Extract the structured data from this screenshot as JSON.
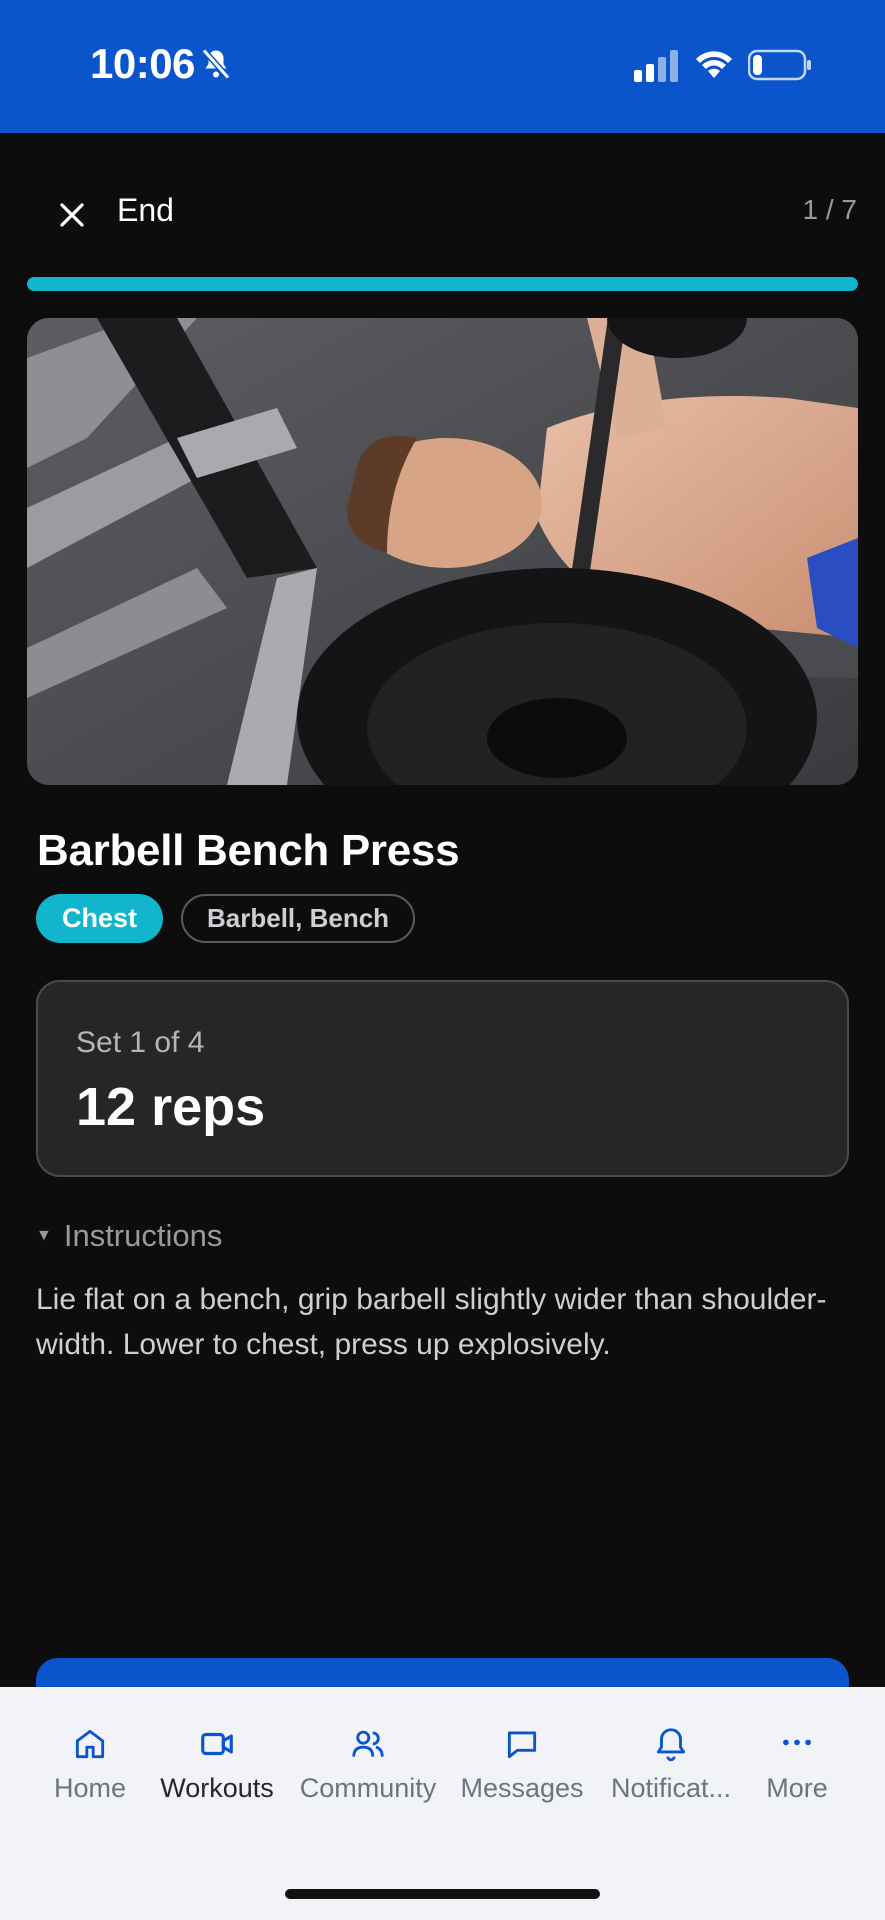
{
  "status_bar": {
    "time": "10:06",
    "bg_color": "#0a55cc"
  },
  "header": {
    "close_icon": "close-icon",
    "end_label": "End",
    "counter": "1 / 7",
    "progress": 1.0,
    "progress_color": "#12b6cc"
  },
  "exercise": {
    "image": "barbell-bench-press-photo",
    "title": "Barbell Bench Press",
    "muscle_tag": "Chest",
    "equipment_tag": "Barbell, Bench"
  },
  "set_card": {
    "set_label": "Set 1 of 4",
    "reps_label": "12 reps"
  },
  "instructions": {
    "toggle_label": "Instructions",
    "text": "Lie flat on a bench, grip barbell slightly wider than shoulder-width. Lower to chest, press up explosively."
  },
  "tab_bar": {
    "active_color": "#0a55cc",
    "inactive_color": "#6b7480",
    "tabs": [
      {
        "label": "Home",
        "icon": "home-icon"
      },
      {
        "label": "Workouts",
        "icon": "video-icon"
      },
      {
        "label": "Community",
        "icon": "users-icon"
      },
      {
        "label": "Messages",
        "icon": "chat-icon"
      },
      {
        "label": "Notificat...",
        "icon": "bell-icon"
      },
      {
        "label": "More",
        "icon": "more-dots-icon"
      }
    ]
  }
}
